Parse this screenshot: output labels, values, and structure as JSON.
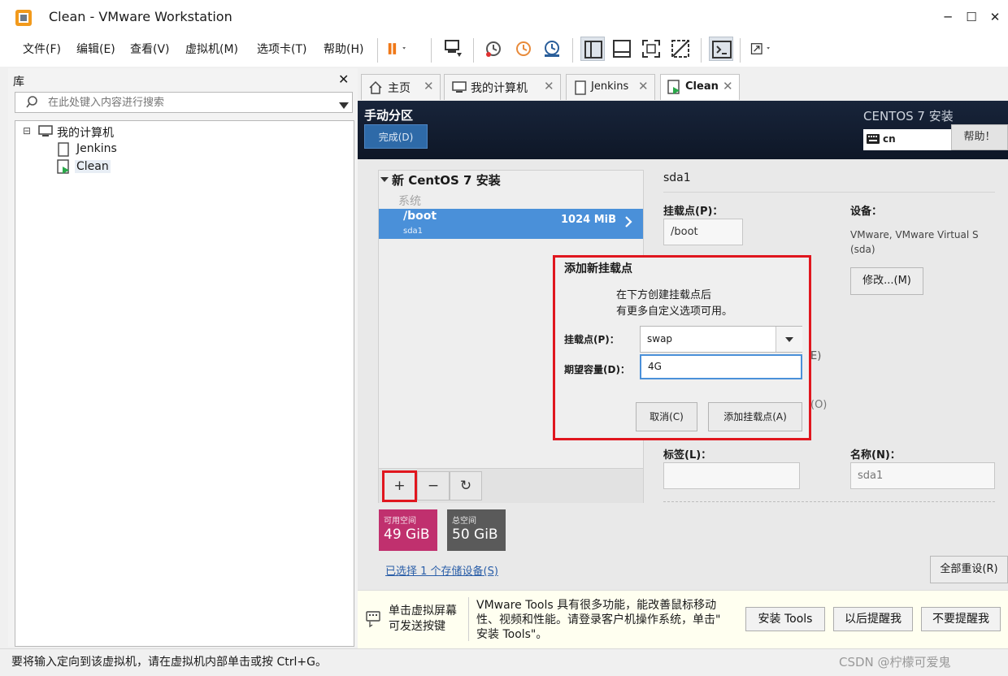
{
  "window": {
    "title": "Clean - VMware Workstation",
    "minimize": "─",
    "maximize": "☐",
    "close": "✕"
  },
  "menu": [
    "文件(F)",
    "编辑(E)",
    "查看(V)",
    "虚拟机(M)",
    "选项卡(T)",
    "帮助(H)"
  ],
  "library": {
    "title": "库",
    "close": "✕",
    "search_placeholder": "在此处键入内容进行搜索",
    "tree": {
      "expander": "⊟",
      "root": "我的计算机",
      "children": [
        "Jenkins",
        "Clean"
      ]
    }
  },
  "tabs": [
    {
      "label": "主页",
      "close": "✕"
    },
    {
      "label": "我的计算机",
      "close": "✕"
    },
    {
      "label": "Jenkins",
      "close": "✕"
    },
    {
      "label": "Clean",
      "close": "✕"
    }
  ],
  "installer": {
    "header_title": "手动分区",
    "done_button": "完成(D)",
    "product_title": "CENTOS 7 安装",
    "keyboard_layout": "cn",
    "help_button": "帮助！",
    "install_title": "新 CentOS 7 安装",
    "system_label": "系统",
    "partition": {
      "name": "/boot",
      "device": "sda1",
      "size": "1024 MiB"
    },
    "add_button": "+",
    "remove_button": "−",
    "refresh_button": "↻",
    "available_space": {
      "label": "可用空间",
      "value": "49 GiB"
    },
    "total_space": {
      "label": "总空间",
      "value": "50 GiB"
    },
    "storage_link": "已选择 1 个存储设备(S)",
    "reset_button": "全部重设(R)",
    "detail": {
      "title": "sda1",
      "mount_label": "挂载点(P)：",
      "mount_value": "/boot",
      "device_label": "设备：",
      "device_value": "VMware, VMware Virtual S",
      "device_value2": "(sda)",
      "modify_button": "修改...(M)",
      "frag_e": "E)",
      "frag_o": "(O)",
      "tag_label": "标签(L)：",
      "name_label": "名称(N)：",
      "name_value": "sda1"
    }
  },
  "dialog": {
    "title": "添加新挂载点",
    "desc_line1": "在下方创建挂载点后",
    "desc_line2": "有更多自定义选项可用。",
    "mount_label": "挂载点(P)：",
    "mount_value": "swap",
    "size_label": "期望容量(D)：",
    "size_value": "4G",
    "cancel_button": "取消(C)",
    "add_button": "添加挂载点(A)"
  },
  "notification": {
    "hint_line1": "单击虚拟屏幕",
    "hint_line2": "可发送按键",
    "msg_line1": "VMware Tools 具有很多功能，能改善鼠标移动",
    "msg_line2": "性、视频和性能。请登录客户机操作系统，单击\"",
    "msg_line3": "安装 Tools\"。",
    "install_button": "安装 Tools",
    "remind_button": "以后提醒我",
    "never_button": "不要提醒我"
  },
  "statusbar": {
    "message": "要将输入定向到该虚拟机，请在虚拟机内部单击或按 Ctrl+G。",
    "watermark": "CSDN @柠檬可爱鬼"
  },
  "colors": {
    "accent": "#4a90d9",
    "highlight": "#e0161e",
    "available": "#c0306e",
    "total": "#5a5a5a",
    "pause": "#f07818"
  }
}
